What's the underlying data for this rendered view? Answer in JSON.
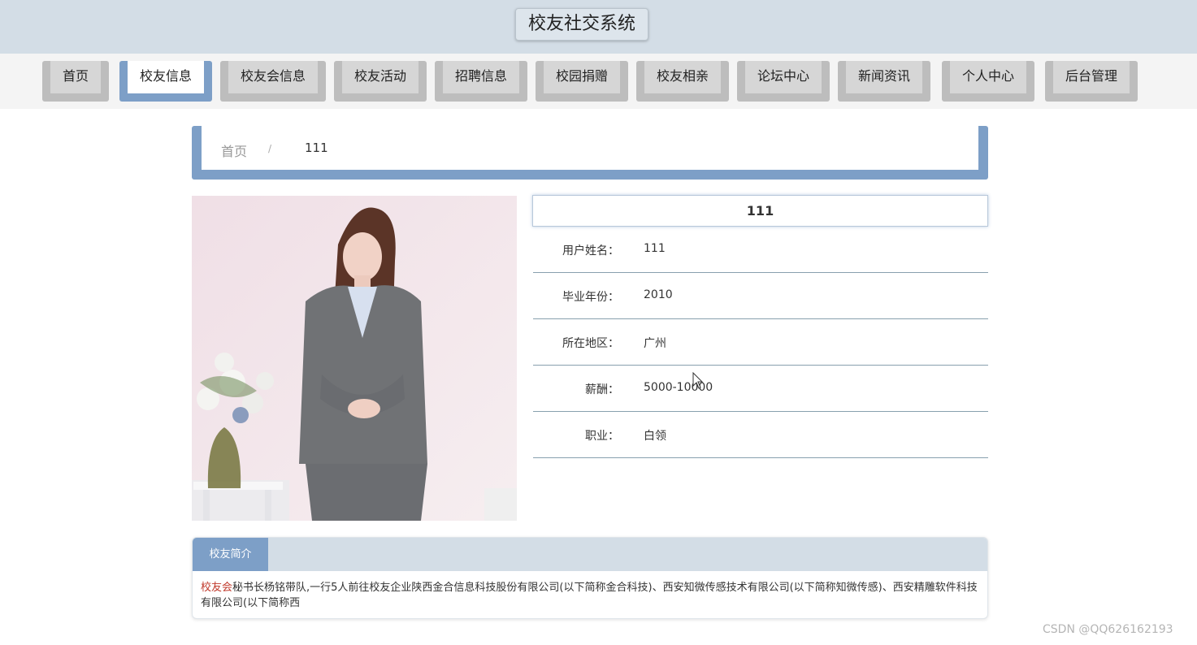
{
  "header": {
    "title": "校友社交系统"
  },
  "nav": {
    "items": [
      {
        "label": "首页",
        "active": false
      },
      {
        "label": "校友信息",
        "active": true
      },
      {
        "label": "校友会信息",
        "active": false
      },
      {
        "label": "校友活动",
        "active": false
      },
      {
        "label": "招聘信息",
        "active": false
      },
      {
        "label": "校园捐赠",
        "active": false
      },
      {
        "label": "校友相亲",
        "active": false
      },
      {
        "label": "论坛中心",
        "active": false
      },
      {
        "label": "新闻资讯",
        "active": false
      },
      {
        "label": "个人中心",
        "active": false
      },
      {
        "label": "后台管理",
        "active": false
      }
    ]
  },
  "breadcrumb": {
    "home": "首页",
    "separator": "/",
    "current": "111"
  },
  "detail": {
    "title": "111",
    "rows": [
      {
        "label": "用户姓名：",
        "value": "111"
      },
      {
        "label": "毕业年份：",
        "value": "2010"
      },
      {
        "label": "所在地区：",
        "value": "广州"
      },
      {
        "label": "薪酬：",
        "value": "5000-10000"
      },
      {
        "label": "职业：",
        "value": "白领"
      }
    ]
  },
  "intro": {
    "tab_label": "校友简介",
    "highlight": "校友会",
    "text": "秘书长杨铭带队,一行5人前往校友企业陕西金合信息科技股份有限公司(以下简称金合科技)、西安知微传感技术有限公司(以下简称知微传感)、西安精雕软件科技有限公司(以下简称西"
  },
  "watermark": "CSDN @QQ626162193",
  "colors": {
    "accent": "#7d9fc7",
    "header_bg": "#d3dde6",
    "highlight": "#c0392b"
  }
}
